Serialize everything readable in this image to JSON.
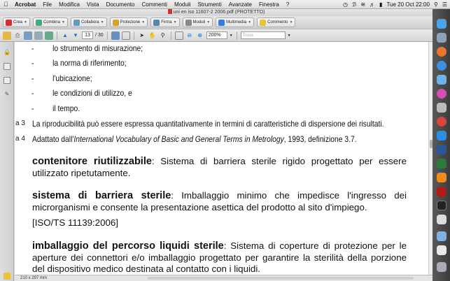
{
  "menubar": {
    "apple": "",
    "items": [
      "Acrobat",
      "File",
      "Modifica",
      "Vista",
      "Documento",
      "Commenti",
      "Moduli",
      "Strumenti",
      "Avanzate",
      "Finestra",
      "?"
    ],
    "clock": "Tue 20 Oct  22:00"
  },
  "window": {
    "title": "uni en iso 11607-2 2006.pdf (PROTETTO)"
  },
  "toolbar": {
    "crea": "Crea",
    "combina": "Combina",
    "collabora": "Collabora",
    "protezione": "Protezione",
    "firma": "Firma",
    "moduli": "Moduli",
    "multimedia": "Multimedia",
    "commento": "Commento"
  },
  "nav": {
    "page": "13",
    "total": "/ 30",
    "zoom": "200%",
    "search_placeholder": "Trova"
  },
  "document": {
    "list": [
      {
        "bullet": "-",
        "text": "lo strumento di misurazione;"
      },
      {
        "bullet": "-",
        "text": "la norma di riferimento;"
      },
      {
        "bullet": "-",
        "text": "l'ubicazione;"
      },
      {
        "bullet": "-",
        "text": "le condizioni di utilizzo, e"
      },
      {
        "bullet": "-",
        "text": "il tempo."
      }
    ],
    "nota3_label": "a 3",
    "nota3": "La riproducibilità può essere espressa quantitativamente in termini di caratteristiche di dispersione dei risultati.",
    "nota4_label": "a 4",
    "nota4_pre": "Adattato dall'",
    "nota4_italic": "International Vocabulary of Basic and General Terms in Metrology",
    "nota4_post": ", 1993, definizione 3.7.",
    "terms": [
      {
        "term": "contenitore riutilizzabile",
        "def": ": Sistema di barriera sterile rigido progettato per essere utilizzato ripetutamente."
      },
      {
        "term": "sistema di barriera sterile",
        "def": ": Imballaggio minimo che impedisce l'ingresso dei microrganismi e consente la presentazione asettica del prodotto al sito d'impiego."
      },
      {
        "term": "imballaggio del percorso liquidi sterile",
        "def": ": Sistema di coperture di protezione per le aperture dei connettori e/o imballaggio progettato per garantire la sterilità della porzione del dispositivo medico destinata al contatto con i liquidi."
      }
    ],
    "ref": "[ISO/TS 11139:2006]"
  },
  "status": {
    "page_size": "210 x 297 mm"
  },
  "colors": {
    "dock": "#444444",
    "pdf_red": "#cc3333"
  }
}
